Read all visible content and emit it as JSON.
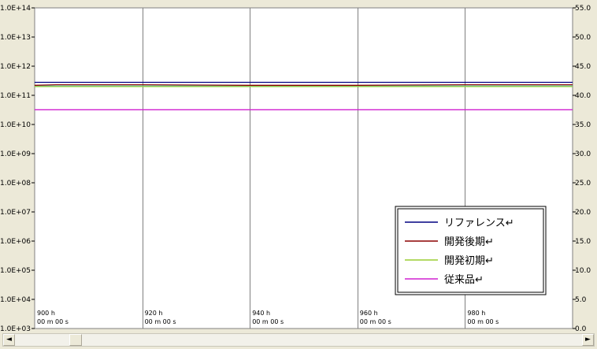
{
  "chart_data": {
    "type": "line",
    "title": "",
    "x_range": [
      900,
      1000
    ],
    "x_ticks": [
      {
        "value": 900,
        "line1": "900 h",
        "line2": "00 m 00 s"
      },
      {
        "value": 920,
        "line1": "920 h",
        "line2": "00 m 00 s"
      },
      {
        "value": 940,
        "line1": "940 h",
        "line2": "00 m 00 s"
      },
      {
        "value": 960,
        "line1": "960 h",
        "line2": "00 m 00 s"
      },
      {
        "value": 980,
        "line1": "980 h",
        "line2": "00 m 00 s"
      }
    ],
    "y_left": {
      "scale": "log",
      "range": [
        1000.0,
        100000000000000.0
      ],
      "tick_labels": [
        "1.0E+03",
        "1.0E+04",
        "1.0E+05",
        "1.0E+06",
        "1.0E+07",
        "1.0E+08",
        "1.0E+09",
        "1.0E+10",
        "1.0E+11",
        "1.0E+12",
        "1.0E+13",
        "1.0E+14"
      ]
    },
    "y_right": {
      "scale": "linear",
      "range": [
        0,
        55
      ],
      "tick_labels": [
        "0.0",
        "5.0",
        "10.0",
        "15.0",
        "20.0",
        "25.0",
        "30.0",
        "35.0",
        "40.0",
        "45.0",
        "50.0",
        "55.0"
      ]
    },
    "grid": {
      "vertical": true,
      "horizontal": false
    },
    "legend_position": "bottom-right",
    "series": [
      {
        "name": "リファレンス↵",
        "color": "#000080",
        "x": [
          900,
          1000
        ],
        "y": [
          280000000000.0,
          280000000000.0
        ]
      },
      {
        "name": "開発後期↵",
        "color": "#8b0000",
        "x": [
          900,
          904,
          920,
          940,
          960,
          980,
          1000
        ],
        "y": [
          220000000000.0,
          230000000000.0,
          230000000000.0,
          220000000000.0,
          220000000000.0,
          230000000000.0,
          230000000000.0
        ]
      },
      {
        "name": "開発初期↵",
        "color": "#9acd32",
        "x": [
          900,
          920,
          940,
          960,
          980,
          1000
        ],
        "y": [
          200000000000.0,
          200000000000.0,
          200000000000.0,
          200000000000.0,
          200000000000.0,
          200000000000.0
        ]
      },
      {
        "name": "従来品↵",
        "color": "#d020d0",
        "x": [
          900,
          1000
        ],
        "y": [
          32000000000.0,
          32000000000.0
        ]
      }
    ],
    "extra_lines": [
      {
        "color": "#40e0d0",
        "x": [
          900,
          1000
        ],
        "y": [
          210000000000.0,
          210000000000.0
        ]
      }
    ]
  },
  "scrollbar": {
    "left_arrow": "◄",
    "right_arrow": "►"
  }
}
